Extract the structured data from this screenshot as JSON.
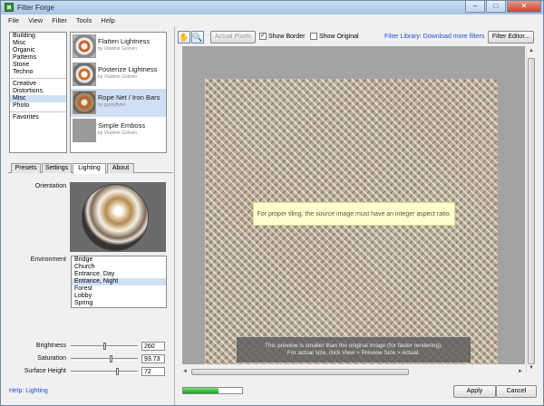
{
  "window": {
    "title": "Filter Forge",
    "controls": {
      "minimize": "–",
      "maximize": "□",
      "close": "✕"
    }
  },
  "menu": [
    "File",
    "View",
    "Filter",
    "Tools",
    "Help"
  ],
  "categories": {
    "group1": [
      "Building",
      "Misc",
      "Organic",
      "Patterns",
      "Stone",
      "Techno"
    ],
    "group2": [
      "Creative",
      "Distortions",
      "Misc",
      "Photo"
    ],
    "group3": [
      "Favorites"
    ],
    "selected": "Misc"
  },
  "filters": [
    {
      "name": "Flatten Lightness",
      "author": "by Vladimir Golovin"
    },
    {
      "name": "Posterize Lightness",
      "author": "by Vladimir Golovin"
    },
    {
      "name": "Rope Net / Iron Bars",
      "author": "by gypsyflyter"
    },
    {
      "name": "Simple Emboss",
      "author": "by Vladimir Golovin"
    }
  ],
  "tabs": [
    "Presets",
    "Settings",
    "Lighting",
    "About"
  ],
  "active_tab": "Lighting",
  "lighting": {
    "orientation_label": "Orientation",
    "environment_label": "Environment",
    "environments": [
      "Bridge",
      "Church",
      "Entrance, Day",
      "Entrance, Night",
      "Forest",
      "Lobby",
      "Spring"
    ],
    "selected_environment": "Entrance, Night",
    "brightness": {
      "label": "Brightness",
      "value": "260",
      "level": 0.52
    },
    "saturation": {
      "label": "Saturation",
      "value": "93.73",
      "level": 0.62
    },
    "surface_height": {
      "label": "Surface Height",
      "value": "72",
      "level": 0.72
    }
  },
  "help_link": "Help: Lighting",
  "toolbar": {
    "hand_icon": "✋",
    "zoom_icon": "🔍",
    "actual_pixels": "Actual Pixels",
    "show_border": "Show Border",
    "show_border_checked": "✓",
    "show_original": "Show Original",
    "library_link": "Filter Library: Download more filters",
    "filter_editor": "Filter Editor..."
  },
  "preview": {
    "tooltip": "For proper tiling, the source image must have an integer aspect ratio.",
    "info_line1": "This preview is smaller than the original image (for faster rendering).",
    "info_line2": "For actual size, click View > Preview Size > Actual."
  },
  "scroll": {
    "up": "▲",
    "down": "▼",
    "left": "◄",
    "right": "►"
  },
  "progress": {
    "level": 0.6
  },
  "buttons": {
    "apply": "Apply",
    "cancel": "Cancel"
  },
  "colors": {
    "accent": "#1d4ed8",
    "selection": "#cfe0f5",
    "progress": "#19a319"
  }
}
